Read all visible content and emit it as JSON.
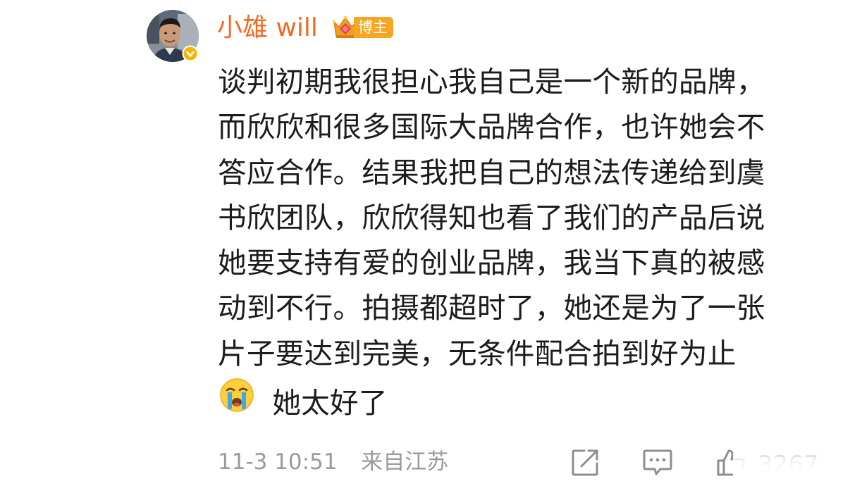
{
  "author": {
    "name": "小雄 will",
    "badge_label": "博主"
  },
  "comment": {
    "lines": [
      "谈判初期我很担心我自己是一个新的品牌，",
      "而欣欣和很多国际大品牌合作，也许她会不",
      "答应合作。结果我把自己的想法传递给到虞",
      "书欣团队，欣欣得知也看了我们的产品后说",
      "她要支持有爱的创业品牌，我当下真的被感",
      "动到不行。拍摄都超时了，她还是为了一张",
      "片子要达到完美，无条件配合拍到好为止"
    ],
    "last_line_emoji": "crying-face-icon",
    "last_line_text": "她太好了"
  },
  "footer": {
    "timestamp": "11-3 10:51",
    "source": "来自江苏",
    "like_count": "3267"
  },
  "colors": {
    "name": "#f26a21",
    "badge": "#f5a623",
    "text": "#1c1c1c",
    "meta": "#9a9a9a",
    "verified": "#f7b500"
  }
}
